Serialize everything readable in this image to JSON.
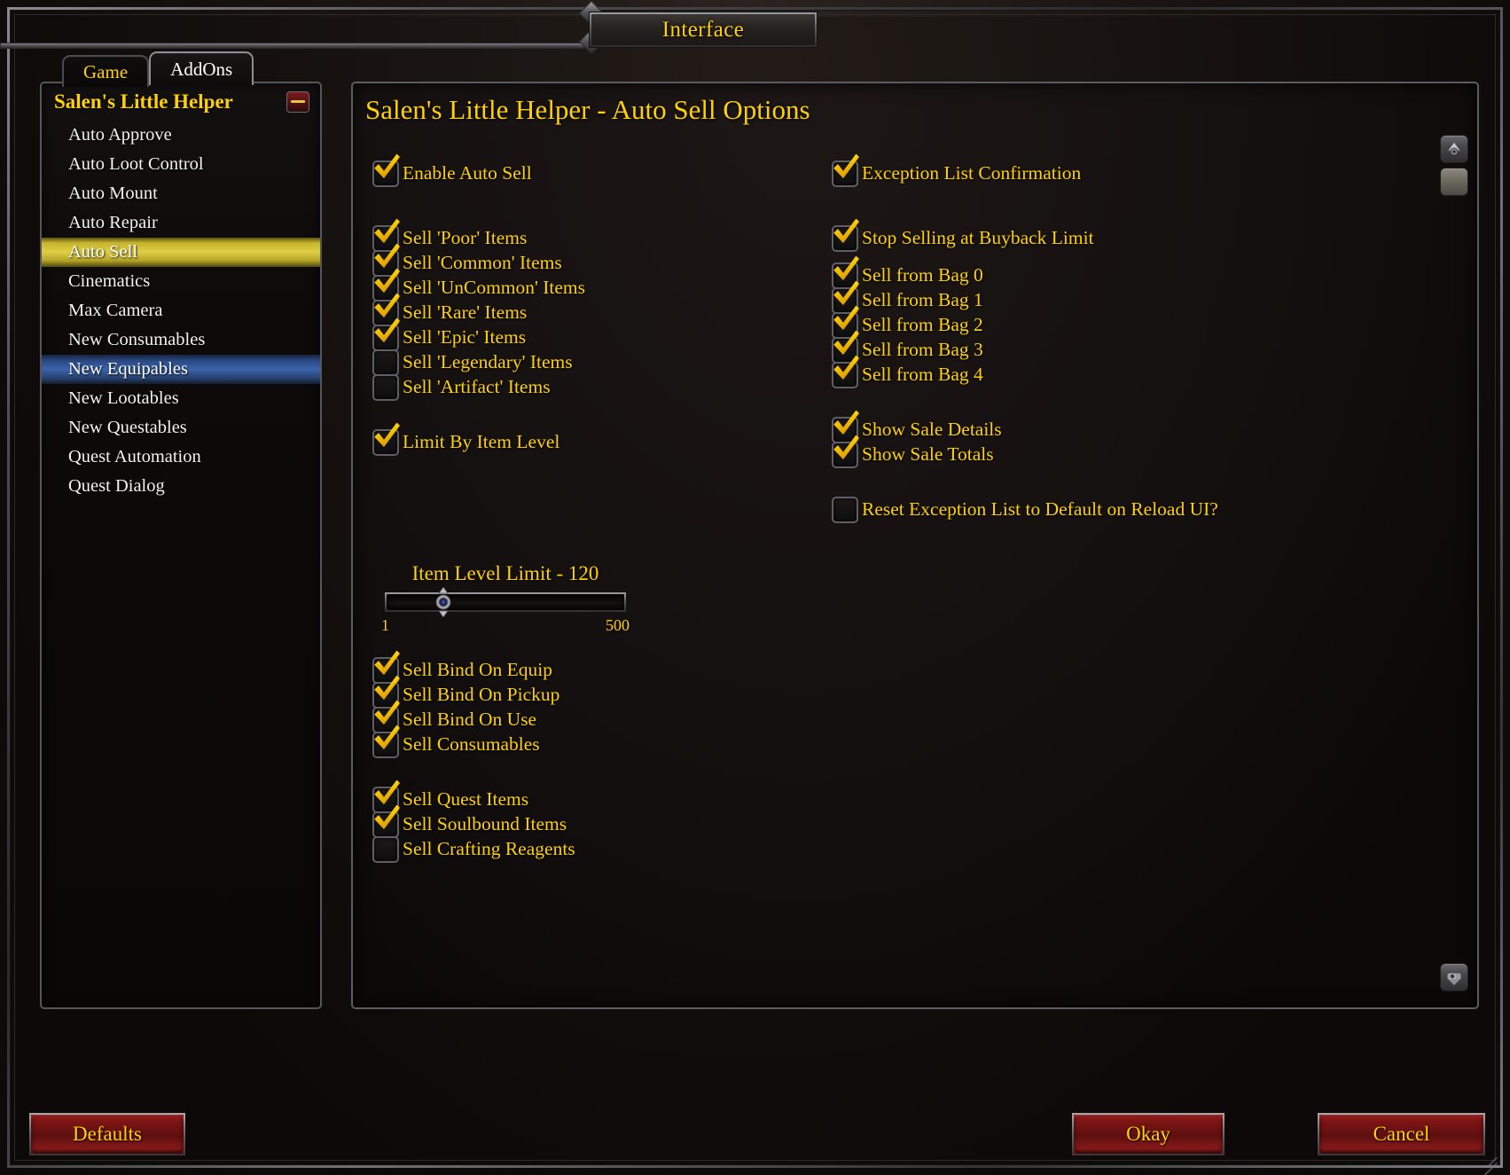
{
  "window": {
    "title": "Interface"
  },
  "tabs": [
    {
      "label": "Game",
      "active": false
    },
    {
      "label": "AddOns",
      "active": true
    }
  ],
  "sidebar": {
    "header": "Salen's Little Helper",
    "collapse_icon": "minus-icon",
    "items": [
      {
        "label": "Auto Approve",
        "state": "normal"
      },
      {
        "label": "Auto Loot Control",
        "state": "normal"
      },
      {
        "label": "Auto Mount",
        "state": "normal"
      },
      {
        "label": "Auto Repair",
        "state": "normal"
      },
      {
        "label": "Auto Sell",
        "state": "selected"
      },
      {
        "label": "Cinematics",
        "state": "normal"
      },
      {
        "label": "Max Camera",
        "state": "normal"
      },
      {
        "label": "New Consumables",
        "state": "normal"
      },
      {
        "label": "New Equipables",
        "state": "hover"
      },
      {
        "label": "New Lootables",
        "state": "normal"
      },
      {
        "label": "New Questables",
        "state": "normal"
      },
      {
        "label": "Quest Automation",
        "state": "normal"
      },
      {
        "label": "Quest Dialog",
        "state": "normal"
      }
    ]
  },
  "content": {
    "title": "Salen's Little Helper - Auto Sell Options",
    "left_column": [
      {
        "type": "checkbox",
        "label": "Enable Auto Sell",
        "checked": true
      },
      {
        "type": "gap-lg"
      },
      {
        "type": "checkbox",
        "label": "Sell 'Poor' Items",
        "checked": true
      },
      {
        "type": "checkbox",
        "label": "Sell 'Common' Items",
        "checked": true
      },
      {
        "type": "checkbox",
        "label": "Sell 'UnCommon' Items",
        "checked": true
      },
      {
        "type": "checkbox",
        "label": "Sell 'Rare' Items",
        "checked": true
      },
      {
        "type": "checkbox",
        "label": "Sell 'Epic' Items",
        "checked": true
      },
      {
        "type": "checkbox",
        "label": "Sell 'Legendary' Items",
        "checked": false
      },
      {
        "type": "checkbox",
        "label": "Sell 'Artifact' Items",
        "checked": false
      },
      {
        "type": "gap-md"
      },
      {
        "type": "checkbox",
        "label": "Limit By Item Level",
        "checked": true
      }
    ],
    "left_column_lower": [
      {
        "type": "checkbox",
        "label": "Sell Bind On Equip",
        "checked": true
      },
      {
        "type": "checkbox",
        "label": "Sell Bind On Pickup",
        "checked": true
      },
      {
        "type": "checkbox",
        "label": "Sell Bind On Use",
        "checked": true
      },
      {
        "type": "checkbox",
        "label": "Sell Consumables",
        "checked": true
      },
      {
        "type": "gap-md"
      },
      {
        "type": "checkbox",
        "label": "Sell Quest Items",
        "checked": true
      },
      {
        "type": "checkbox",
        "label": "Sell Soulbound Items",
        "checked": true
      },
      {
        "type": "checkbox",
        "label": "Sell Crafting Reagents",
        "checked": false
      }
    ],
    "right_column": [
      {
        "type": "checkbox",
        "label": "Exception List Confirmation",
        "checked": true
      },
      {
        "type": "gap-lg"
      },
      {
        "type": "checkbox",
        "label": "Stop Selling at Buyback Limit",
        "checked": true
      },
      {
        "type": "gap-sm"
      },
      {
        "type": "checkbox",
        "label": "Sell from Bag 0",
        "checked": true
      },
      {
        "type": "checkbox",
        "label": "Sell from Bag 1",
        "checked": true
      },
      {
        "type": "checkbox",
        "label": "Sell from Bag 2",
        "checked": true
      },
      {
        "type": "checkbox",
        "label": "Sell from Bag 3",
        "checked": true
      },
      {
        "type": "checkbox",
        "label": "Sell from Bag 4",
        "checked": true
      },
      {
        "type": "gap-md"
      },
      {
        "type": "checkbox",
        "label": "Show Sale Details",
        "checked": true
      },
      {
        "type": "checkbox",
        "label": "Show Sale Totals",
        "checked": true
      },
      {
        "type": "gap-md"
      },
      {
        "type": "checkbox",
        "label": "Reset Exception List to Default on Reload UI?",
        "checked": false
      }
    ],
    "slider": {
      "label": "Item Level Limit - 120",
      "value": 120,
      "min_label": "1",
      "max_label": "500",
      "min": 1,
      "max": 500,
      "thumb_percent": 24
    },
    "utility_buttons": [
      {
        "name": "addon-compartment-icon"
      },
      {
        "name": "blank-panel-icon"
      },
      {
        "name": "camera-icon"
      }
    ]
  },
  "footer": {
    "defaults_label": "Defaults",
    "okay_label": "Okay",
    "cancel_label": "Cancel"
  },
  "colors": {
    "gold_text": "#ffd100",
    "selected_row": "#e0cf45",
    "hover_row": "#3a63ad",
    "button_red": "#7c1414"
  }
}
